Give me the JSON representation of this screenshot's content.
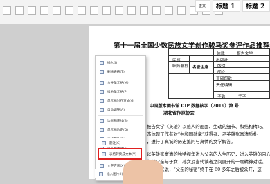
{
  "ribbon": {
    "style_normal": "正文",
    "style_h1": "标题 1",
    "style_h2": "标题 2"
  },
  "document": {
    "title": "第十一届全国少数民族文学创作骏马奖参评作品推荐表",
    "table": {
      "genre_label": "体裁",
      "genre_value": "报告文学",
      "ethnicity_label": "民族",
      "title_label": "职务职称",
      "publisher_label": "出版社",
      "edition_label": "版次",
      "print_label": "印次",
      "printrun_label": "首版印数",
      "editor_label": "责任编辑",
      "wordcount_label": "字数",
      "wordcount_unit": "千字",
      "editor_name": "名誉主席"
    },
    "cip_line": "中国版本图书馆 CIP 数据核字（2019）第          号",
    "recommender": "湖北省作家协会",
    "body_lines": [
      "报告文学《英雄》以感人的画面、生动的细节、和结构精巧、",
      "态体现了作者对“共和国勋章”获得者、老英雄张富清质朴",
      "，进行了真诚的历史追问与真情的文学解答。",
      "以英雄张富清的独特视角进入父亲的人生历史，进入英雄的内心",
      "英雄父亲与子女、孙女及当代读者之间展开的一席精神对话。",
      "为儿女来说，“父亲的秘密”终于在 60 多年之后被公开，这"
    ]
  },
  "context_menu": {
    "items": [
      {
        "label": "插入(I)",
        "icon": "insert-icon"
      },
      {
        "label": "删除表格(T)",
        "icon": "delete-table-icon"
      },
      {
        "label": "合并单元格(M)",
        "icon": "merge-cells-icon"
      },
      {
        "label": "拆分单元格(P)",
        "icon": "split-cells-icon"
      },
      {
        "label": "单元格对齐方式(G)",
        "icon": "cell-align-icon"
      },
      {
        "label": "自动调整(A)",
        "icon": "autofit-icon"
      },
      {
        "label": "边框和底纹(B)",
        "icon": "borders-icon"
      },
      {
        "label": "单元格边距(D)",
        "icon": "cell-margin-icon"
      },
      {
        "label": "表格属性(R)",
        "icon": "table-properties-icon"
      },
      {
        "label": "单元格属性(E)",
        "icon": "cell-properties-icon"
      },
      {
        "label": "标题行重复(H)",
        "icon": "header-repeat-icon"
      },
      {
        "label": "文字方向(X)",
        "icon": "text-direction-icon"
      },
      {
        "label": "题注(C)",
        "icon": "caption-icon"
      },
      {
        "label": "表格转换成文本(V)",
        "icon": "table-to-text-icon"
      },
      {
        "label": "插入图片(I)",
        "icon": "insert-picture-icon"
      }
    ],
    "highlighted_index": 13
  }
}
